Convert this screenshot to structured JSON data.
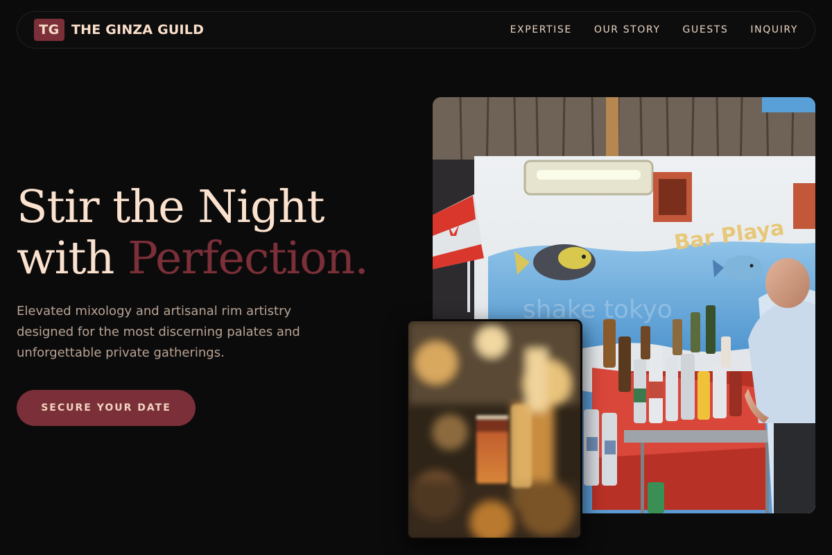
{
  "brand": {
    "logo_initials": "TG",
    "name": "THE GINZA GUILD"
  },
  "nav": {
    "links": [
      "EXPERTISE",
      "OUR STORY",
      "GUESTS",
      "INQUIRY"
    ]
  },
  "hero": {
    "headline_line1": "Stir the Night",
    "headline_with": "with",
    "headline_accent": "Perfection.",
    "lead": "Elevated mixology and artisanal rim artistry designed for the most discerning palates and unforgettable private gatherings.",
    "cta_label": "SECURE YOUR DATE"
  },
  "images": {
    "main_sign_text": "Bar Playa",
    "main_watermark": "shake tokyo"
  },
  "colors": {
    "background": "#0c0b0b",
    "accent": "#7b2f38",
    "headline": "#fbe2cf",
    "body_text": "#b7a394"
  }
}
